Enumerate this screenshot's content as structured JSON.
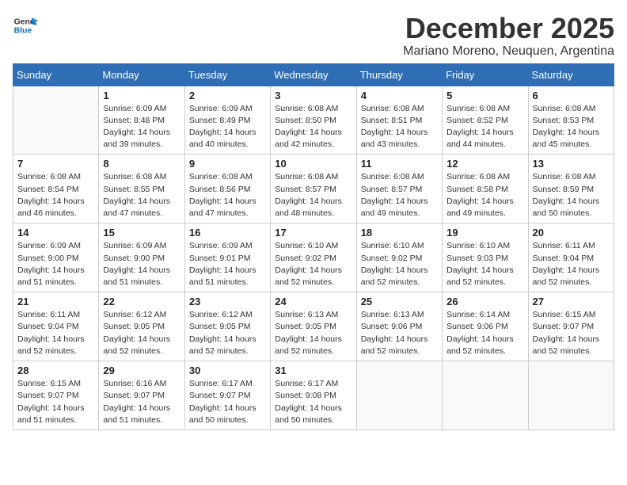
{
  "logo": {
    "text_general": "General",
    "text_blue": "Blue"
  },
  "header": {
    "month": "December 2025",
    "location": "Mariano Moreno, Neuquen, Argentina"
  },
  "days_of_week": [
    "Sunday",
    "Monday",
    "Tuesday",
    "Wednesday",
    "Thursday",
    "Friday",
    "Saturday"
  ],
  "weeks": [
    [
      {
        "day": "",
        "info": ""
      },
      {
        "day": "1",
        "info": "Sunrise: 6:09 AM\nSunset: 8:48 PM\nDaylight: 14 hours\nand 39 minutes."
      },
      {
        "day": "2",
        "info": "Sunrise: 6:09 AM\nSunset: 8:49 PM\nDaylight: 14 hours\nand 40 minutes."
      },
      {
        "day": "3",
        "info": "Sunrise: 6:08 AM\nSunset: 8:50 PM\nDaylight: 14 hours\nand 42 minutes."
      },
      {
        "day": "4",
        "info": "Sunrise: 6:08 AM\nSunset: 8:51 PM\nDaylight: 14 hours\nand 43 minutes."
      },
      {
        "day": "5",
        "info": "Sunrise: 6:08 AM\nSunset: 8:52 PM\nDaylight: 14 hours\nand 44 minutes."
      },
      {
        "day": "6",
        "info": "Sunrise: 6:08 AM\nSunset: 8:53 PM\nDaylight: 14 hours\nand 45 minutes."
      }
    ],
    [
      {
        "day": "7",
        "info": "Sunrise: 6:08 AM\nSunset: 8:54 PM\nDaylight: 14 hours\nand 46 minutes."
      },
      {
        "day": "8",
        "info": "Sunrise: 6:08 AM\nSunset: 8:55 PM\nDaylight: 14 hours\nand 47 minutes."
      },
      {
        "day": "9",
        "info": "Sunrise: 6:08 AM\nSunset: 8:56 PM\nDaylight: 14 hours\nand 47 minutes."
      },
      {
        "day": "10",
        "info": "Sunrise: 6:08 AM\nSunset: 8:57 PM\nDaylight: 14 hours\nand 48 minutes."
      },
      {
        "day": "11",
        "info": "Sunrise: 6:08 AM\nSunset: 8:57 PM\nDaylight: 14 hours\nand 49 minutes."
      },
      {
        "day": "12",
        "info": "Sunrise: 6:08 AM\nSunset: 8:58 PM\nDaylight: 14 hours\nand 49 minutes."
      },
      {
        "day": "13",
        "info": "Sunrise: 6:08 AM\nSunset: 8:59 PM\nDaylight: 14 hours\nand 50 minutes."
      }
    ],
    [
      {
        "day": "14",
        "info": "Sunrise: 6:09 AM\nSunset: 9:00 PM\nDaylight: 14 hours\nand 51 minutes."
      },
      {
        "day": "15",
        "info": "Sunrise: 6:09 AM\nSunset: 9:00 PM\nDaylight: 14 hours\nand 51 minutes."
      },
      {
        "day": "16",
        "info": "Sunrise: 6:09 AM\nSunset: 9:01 PM\nDaylight: 14 hours\nand 51 minutes."
      },
      {
        "day": "17",
        "info": "Sunrise: 6:10 AM\nSunset: 9:02 PM\nDaylight: 14 hours\nand 52 minutes."
      },
      {
        "day": "18",
        "info": "Sunrise: 6:10 AM\nSunset: 9:02 PM\nDaylight: 14 hours\nand 52 minutes."
      },
      {
        "day": "19",
        "info": "Sunrise: 6:10 AM\nSunset: 9:03 PM\nDaylight: 14 hours\nand 52 minutes."
      },
      {
        "day": "20",
        "info": "Sunrise: 6:11 AM\nSunset: 9:04 PM\nDaylight: 14 hours\nand 52 minutes."
      }
    ],
    [
      {
        "day": "21",
        "info": "Sunrise: 6:11 AM\nSunset: 9:04 PM\nDaylight: 14 hours\nand 52 minutes."
      },
      {
        "day": "22",
        "info": "Sunrise: 6:12 AM\nSunset: 9:05 PM\nDaylight: 14 hours\nand 52 minutes."
      },
      {
        "day": "23",
        "info": "Sunrise: 6:12 AM\nSunset: 9:05 PM\nDaylight: 14 hours\nand 52 minutes."
      },
      {
        "day": "24",
        "info": "Sunrise: 6:13 AM\nSunset: 9:05 PM\nDaylight: 14 hours\nand 52 minutes."
      },
      {
        "day": "25",
        "info": "Sunrise: 6:13 AM\nSunset: 9:06 PM\nDaylight: 14 hours\nand 52 minutes."
      },
      {
        "day": "26",
        "info": "Sunrise: 6:14 AM\nSunset: 9:06 PM\nDaylight: 14 hours\nand 52 minutes."
      },
      {
        "day": "27",
        "info": "Sunrise: 6:15 AM\nSunset: 9:07 PM\nDaylight: 14 hours\nand 52 minutes."
      }
    ],
    [
      {
        "day": "28",
        "info": "Sunrise: 6:15 AM\nSunset: 9:07 PM\nDaylight: 14 hours\nand 51 minutes."
      },
      {
        "day": "29",
        "info": "Sunrise: 6:16 AM\nSunset: 9:07 PM\nDaylight: 14 hours\nand 51 minutes."
      },
      {
        "day": "30",
        "info": "Sunrise: 6:17 AM\nSunset: 9:07 PM\nDaylight: 14 hours\nand 50 minutes."
      },
      {
        "day": "31",
        "info": "Sunrise: 6:17 AM\nSunset: 9:08 PM\nDaylight: 14 hours\nand 50 minutes."
      },
      {
        "day": "",
        "info": ""
      },
      {
        "day": "",
        "info": ""
      },
      {
        "day": "",
        "info": ""
      }
    ]
  ]
}
